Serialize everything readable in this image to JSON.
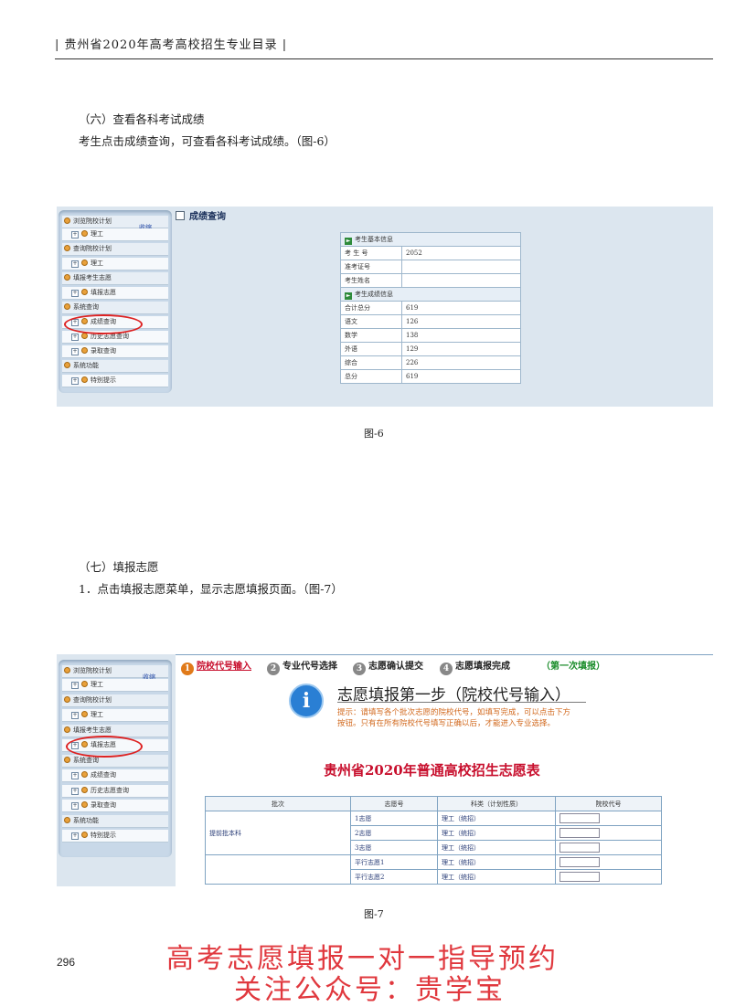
{
  "header": {
    "title": "贵州省2020年高考高校招生专业目录"
  },
  "section6": {
    "heading": "（六）查看各科考试成绩",
    "text": "考生点击成绩查询，可查看各科考试成绩。（图-6）",
    "caption": "图-6"
  },
  "sidebar": {
    "collapse_label": "收缩",
    "rows": [
      "浏览院校计划",
      "理工",
      "查询院校计划",
      "理工",
      "填报考生志愿",
      "填报志愿",
      "系统查询",
      "成绩查询",
      "历史志愿查询",
      "录取查询",
      "系统功能",
      "特别提示"
    ]
  },
  "score": {
    "title": "成绩查询",
    "basic_header": "考生基本信息",
    "basic": [
      {
        "label": "考 生 号",
        "value": "2052"
      },
      {
        "label": "准考证号",
        "value": ""
      },
      {
        "label": "考生姓名",
        "value": ""
      }
    ],
    "score_header": "考生成绩信息",
    "scores": [
      {
        "label": "合计总分",
        "value": "619"
      },
      {
        "label": "语文",
        "value": "126"
      },
      {
        "label": "数学",
        "value": "138"
      },
      {
        "label": "外语",
        "value": "129"
      },
      {
        "label": "综合",
        "value": "226"
      },
      {
        "label": "总分",
        "value": "619"
      }
    ]
  },
  "section7": {
    "heading": "（七）填报志愿",
    "text": "1．点击填报志愿菜单，显示志愿填报页面。（图-7）",
    "caption": "图-7"
  },
  "steps": {
    "s1": "院校代号输入",
    "s2": "专业代号选择",
    "s3": "志愿确认提交",
    "s4": "志愿填报完成",
    "note": "（第一次填报）"
  },
  "notice": {
    "title": "志愿填报第一步（院校代号输入）",
    "tip": "提示：请填写各个批次志愿的院校代号，如填写完成，可以点击下方按钮。只有在所有院校代号填写正确以后，才能进入专业选择。"
  },
  "form": {
    "title": "贵州省2020年普通高校招生志愿表",
    "headers": [
      "批次",
      "志愿号",
      "科类（计划性质）",
      "院校代号"
    ],
    "batch": "提前批本科",
    "rows": [
      {
        "no": "1志愿",
        "type": "理工（统招）"
      },
      {
        "no": "2志愿",
        "type": "理工（统招）"
      },
      {
        "no": "3志愿",
        "type": "理工（统招）"
      },
      {
        "no": "平行志愿1",
        "type": "理工（统招）"
      },
      {
        "no": "平行志愿2",
        "type": "理工（统招）"
      }
    ]
  },
  "page_number": "296",
  "watermark": {
    "line1": "高考志愿填报一对一指导预约",
    "line2": "关注公众号：贵学宝"
  },
  "colors": {
    "panel": "#dce6ef",
    "link_red": "#c8102e",
    "watermark": "#e0383e",
    "form_title": "#c8102e"
  }
}
